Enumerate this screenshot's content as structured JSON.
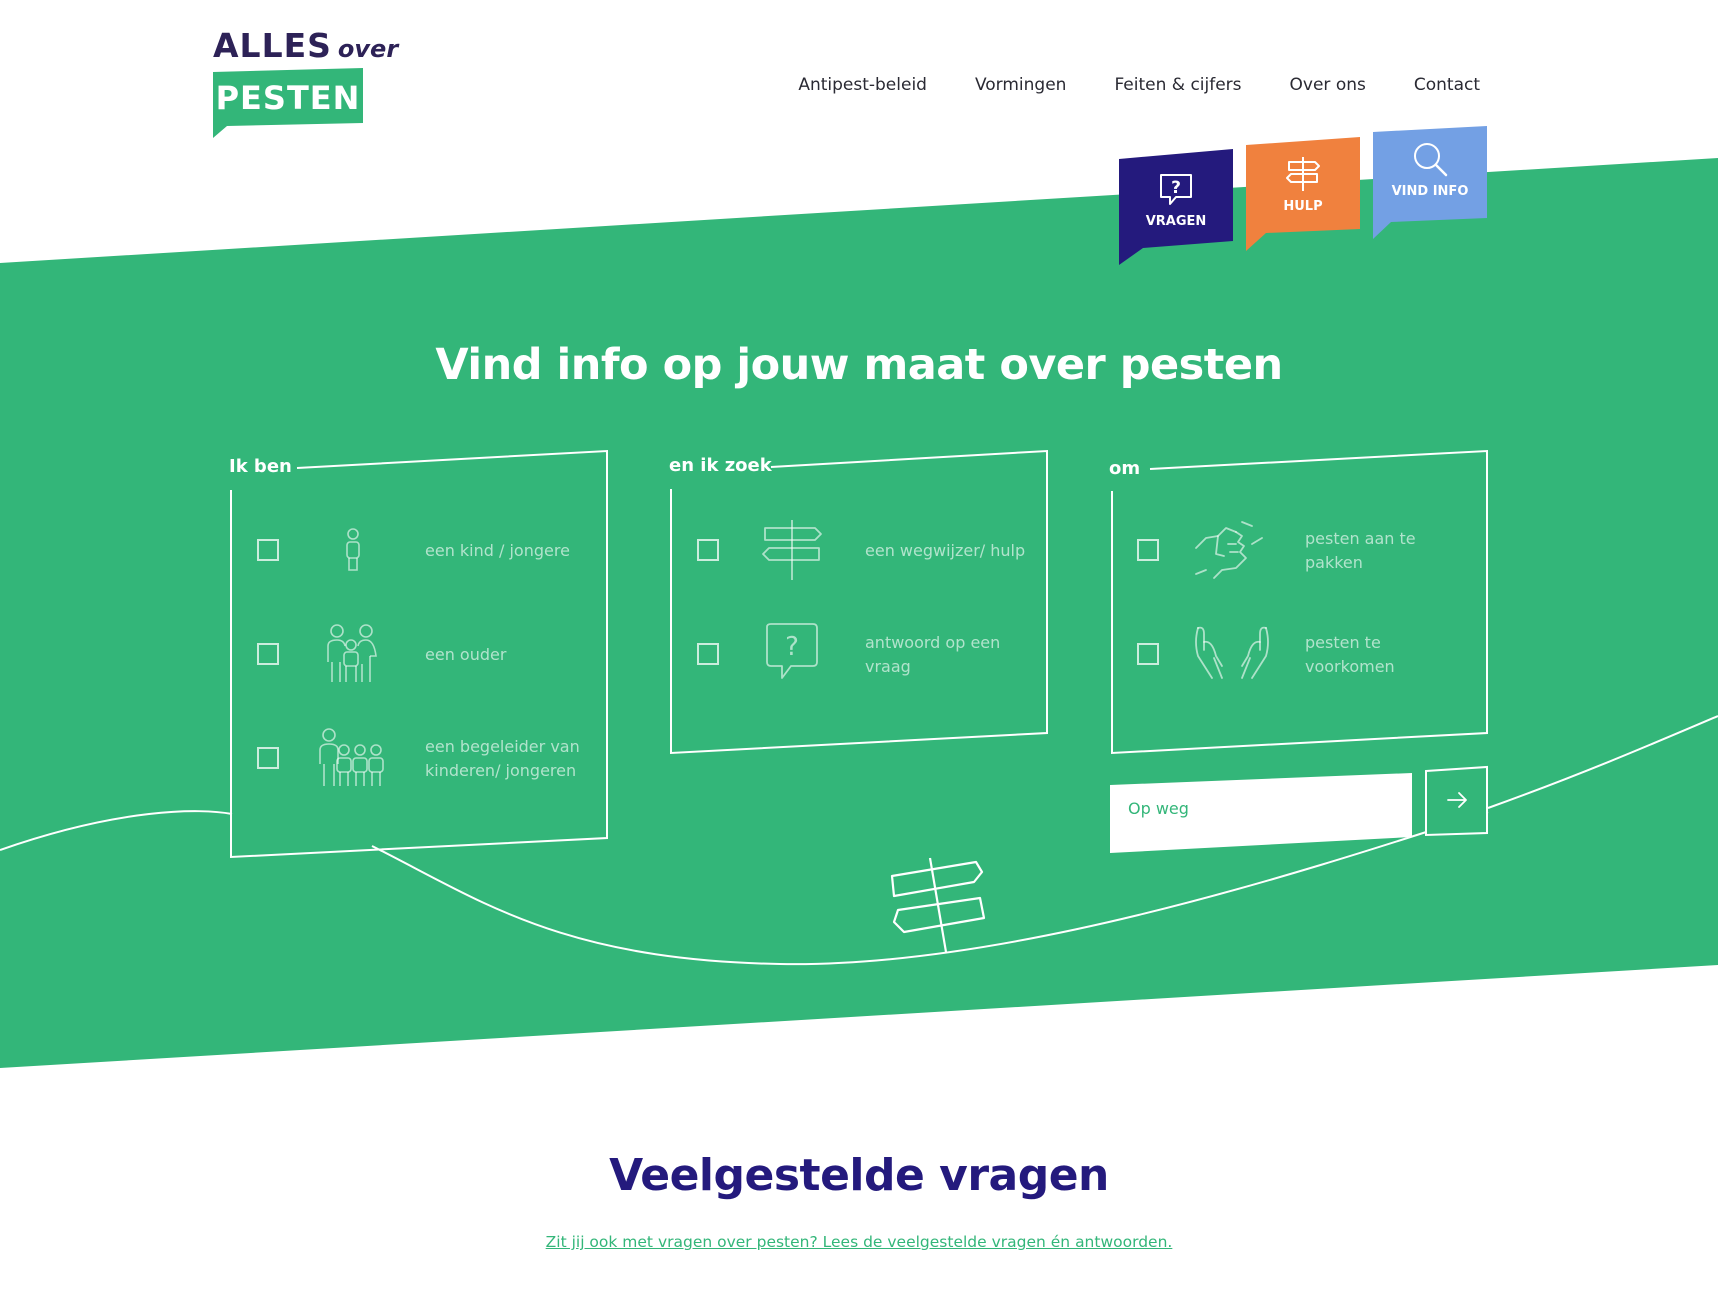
{
  "brand": {
    "logo_top": "ALLES",
    "logo_over": "over",
    "logo_bottom": "PESTEN",
    "colors": {
      "green": "#33b679",
      "navy": "#241a7d",
      "dark_purple": "#2d2257",
      "orange": "#f0813e",
      "light_blue": "#73a0e4"
    }
  },
  "nav": {
    "items": [
      "Antipest-beleid",
      "Vormingen",
      "Feiten & cijfers",
      "Over ons",
      "Contact"
    ]
  },
  "quick_tabs": [
    {
      "label": "VRAGEN",
      "icon": "question-bubble-icon",
      "color": "#241a7d"
    },
    {
      "label": "HULP",
      "icon": "signpost-icon",
      "color": "#f0813e"
    },
    {
      "label": "VIND INFO",
      "icon": "search-icon",
      "color": "#73a0e4"
    }
  ],
  "hero": {
    "title": "Vind info op jouw maat over pesten"
  },
  "filters": {
    "who": {
      "label": "Ik ben",
      "options": [
        {
          "text": "een kind / jongere",
          "icon": "child-icon"
        },
        {
          "text": "een ouder",
          "icon": "family-icon"
        },
        {
          "text": "een begeleider van kinderen/ jongeren",
          "icon": "group-icon"
        }
      ]
    },
    "what": {
      "label": "en ik zoek",
      "options": [
        {
          "text": "een wegwijzer/ hulp",
          "icon": "signpost-icon"
        },
        {
          "text": "antwoord op een vraag",
          "icon": "question-bubble-icon"
        }
      ]
    },
    "goal": {
      "label": "om",
      "options": [
        {
          "text": "pesten aan te pakken",
          "icon": "handshake-icon"
        },
        {
          "text": "pesten te voorkomen",
          "icon": "protecting-hands-icon"
        }
      ]
    }
  },
  "search": {
    "placeholder": "Op weg",
    "submit_icon": "arrow-right-icon"
  },
  "faq": {
    "title": "Veelgestelde vragen",
    "link": "Zit jij ook met vragen over pesten? Lees de veelgestelde vragen én antwoorden."
  }
}
